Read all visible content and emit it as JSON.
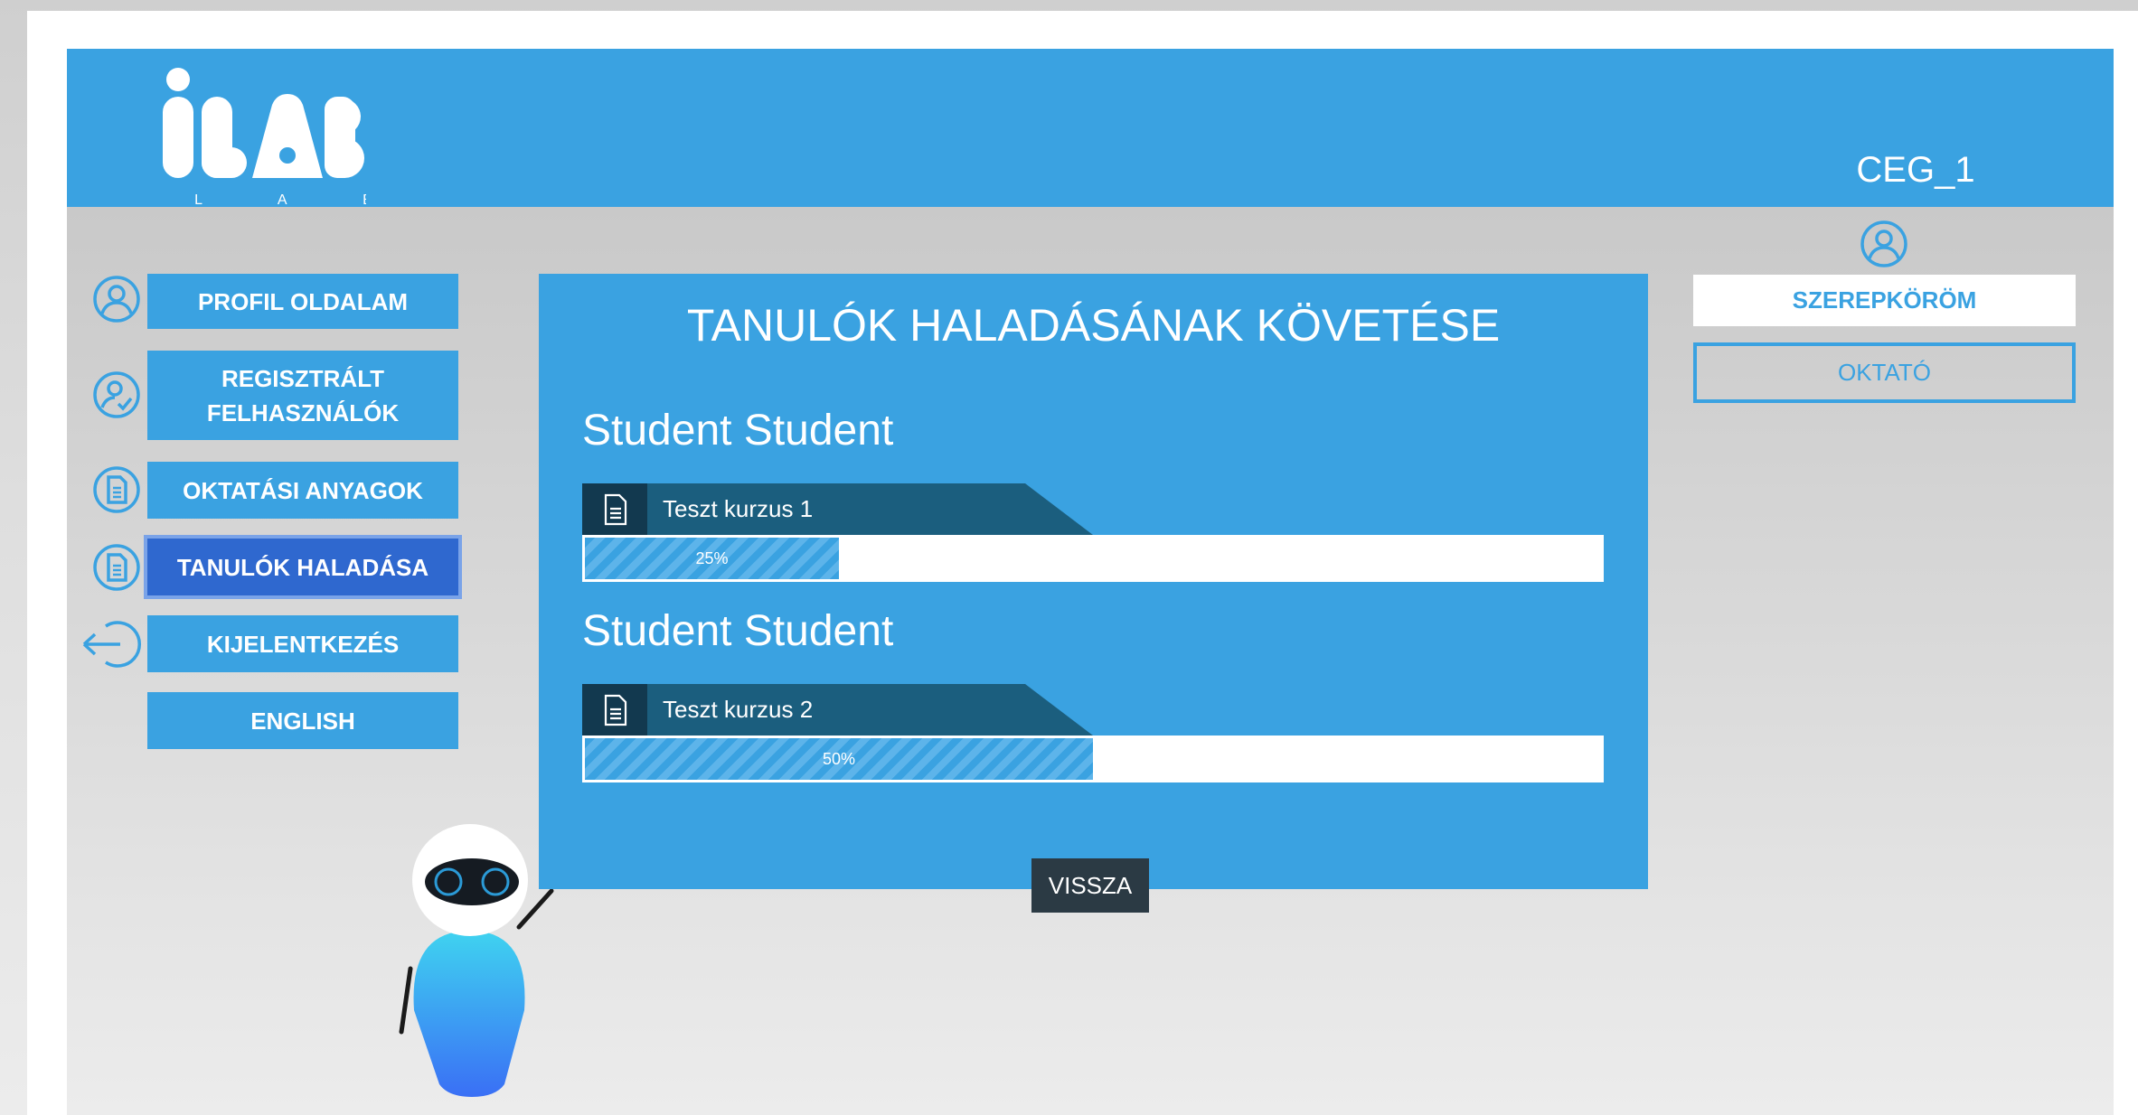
{
  "header": {
    "logo_letters": "I L A B",
    "company_name": "CEG_1"
  },
  "sidebar": {
    "items": [
      {
        "label": "PROFIL OLDALAM",
        "icon": "user-circle-icon"
      },
      {
        "label": "REGISZTRÁLT FELHASZNÁLÓK",
        "icon": "user-check-icon"
      },
      {
        "label": "OKTATÁSI ANYAGOK",
        "icon": "document-icon"
      },
      {
        "label": "TANULÓK HALADÁSA",
        "icon": "document-icon",
        "active": true
      },
      {
        "label": "KIJELENTKEZÉS",
        "icon": "logout-arrow-icon"
      },
      {
        "label": "ENGLISH"
      }
    ]
  },
  "main": {
    "title": "TANULÓK HALADÁSÁNAK KÖVETÉSE",
    "entries": [
      {
        "student": "Student Student",
        "course": "Teszt kurzus 1",
        "progress": 25,
        "progress_label": "25%"
      },
      {
        "student": "Student Student",
        "course": "Teszt kurzus 2",
        "progress": 50,
        "progress_label": "50%"
      }
    ],
    "back_label": "VISSZA"
  },
  "role": {
    "title": "SZEREPKÖRÖM",
    "value": "OKTATÓ"
  },
  "colors": {
    "primary": "#3aa2e1",
    "active": "#2f68cf",
    "course_tab": "#1b5e7e",
    "course_icon_bg": "#12394f",
    "back_button": "#2b3a44"
  }
}
